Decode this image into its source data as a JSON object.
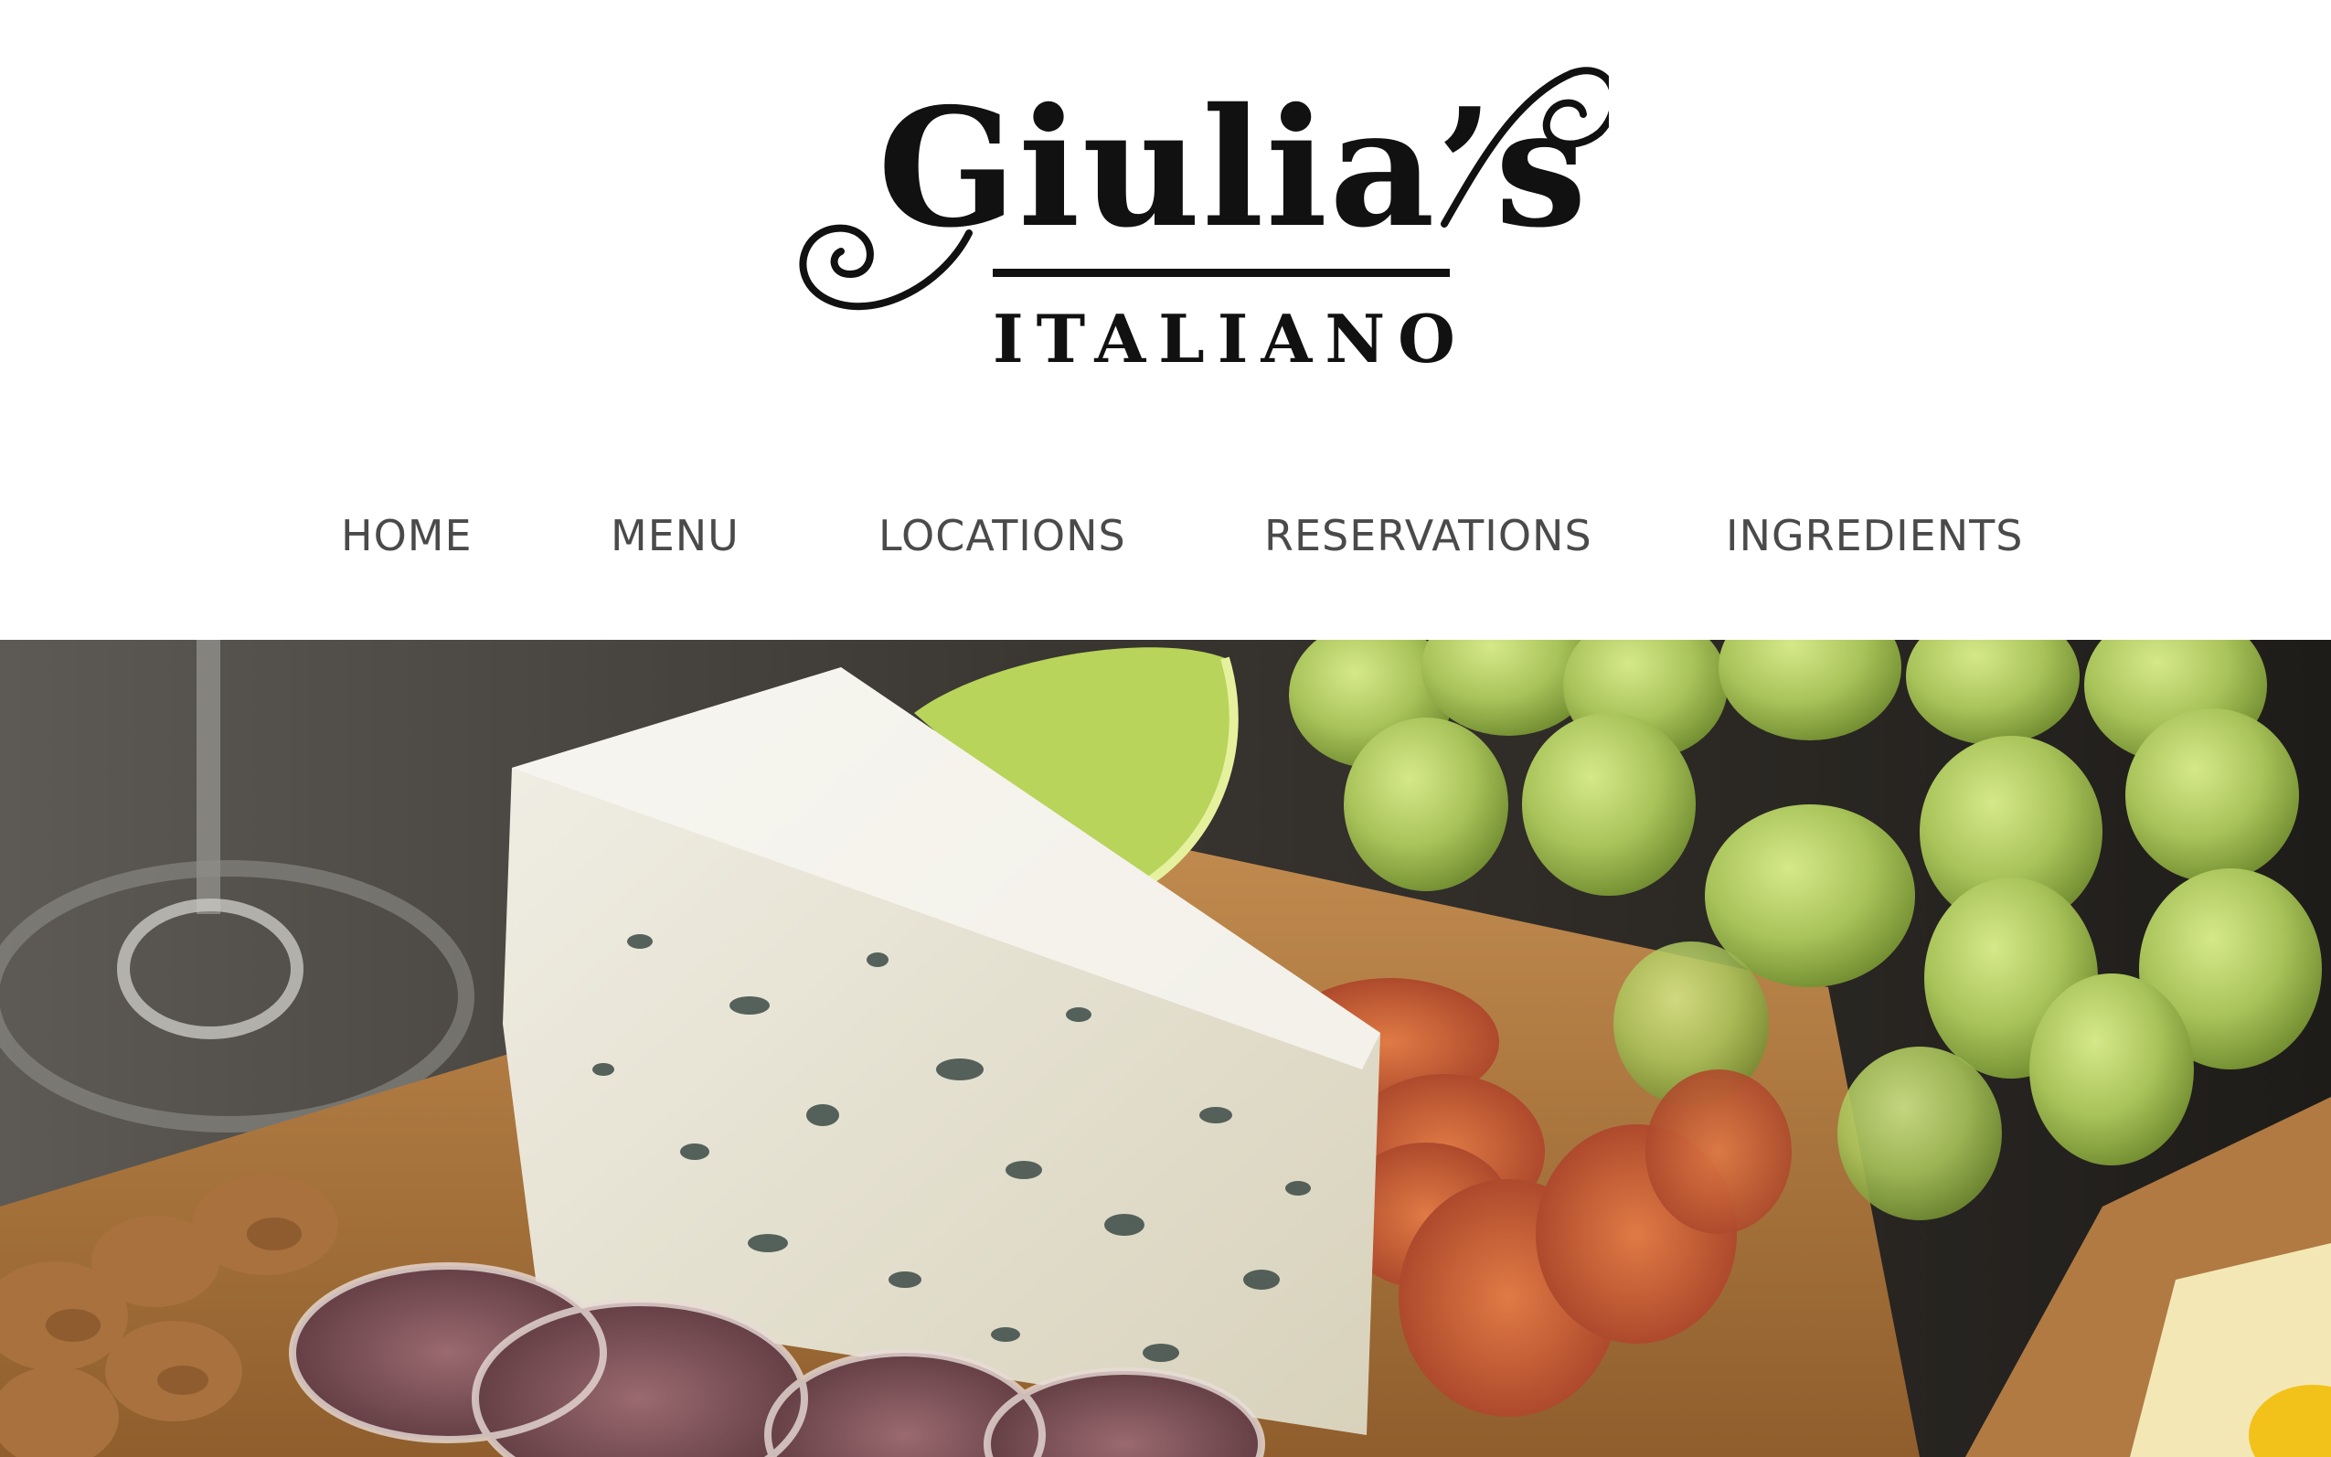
{
  "logo": {
    "name": "Giulia’s",
    "subtitle": "ITALIANO"
  },
  "nav": {
    "items": [
      {
        "label": "HOME"
      },
      {
        "label": "MENU"
      },
      {
        "label": "LOCATIONS"
      },
      {
        "label": "RESERVATIONS"
      },
      {
        "label": "INGREDIENTS"
      }
    ]
  },
  "hero": {
    "image": "cheese-charcuterie-board-photo"
  },
  "colors": {
    "background": "#ffffff",
    "logo": "#111111",
    "nav_text": "#4a4a4a"
  }
}
